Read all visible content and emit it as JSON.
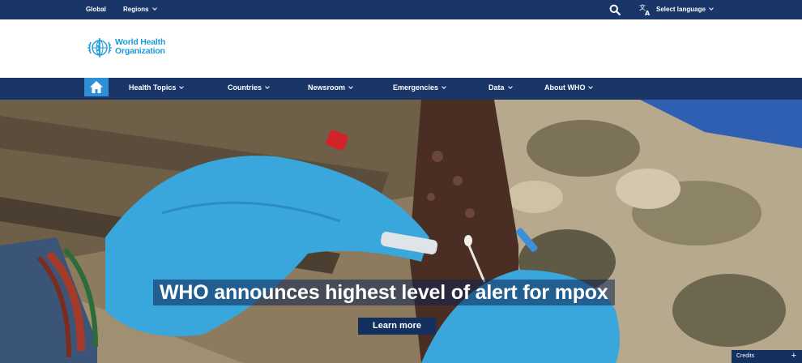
{
  "topbar": {
    "global_label": "Global",
    "regions_label": "Regions",
    "language_label": "Select language",
    "search_icon": "search-icon",
    "language_icon": "translate-icon"
  },
  "logo": {
    "line1": "World Health",
    "line2": "Organization"
  },
  "nav": {
    "home_icon": "home-icon",
    "items": [
      {
        "label": "Health Topics"
      },
      {
        "label": "Countries"
      },
      {
        "label": "Newsroom"
      },
      {
        "label": "Emergencies"
      },
      {
        "label": "Data"
      },
      {
        "label": "About WHO"
      }
    ]
  },
  "hero": {
    "headline": "WHO announces highest level of alert for mpox",
    "button_label": "Learn more",
    "credits_label": "Credits",
    "credits_icon": "+"
  },
  "colors": {
    "navy": "#1a3668",
    "brand_blue": "#1b9bd7",
    "home_button": "#2d8fd5",
    "button_bg": "#13305f"
  }
}
